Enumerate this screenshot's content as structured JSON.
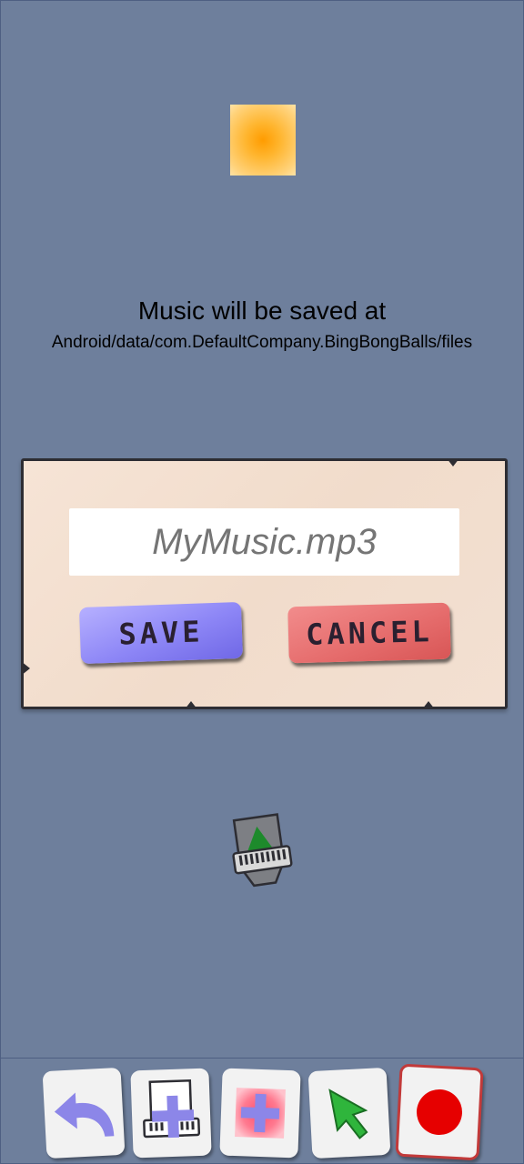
{
  "message": {
    "title": "Music will be saved at",
    "path": "Android/data/com.DefaultCompany.BingBongBalls/files"
  },
  "dialog": {
    "filename_placeholder": "MyMusic.mp3",
    "filename_value": "",
    "save_label": "SAVE",
    "cancel_label": "CANCEL"
  },
  "toolbar": {
    "items": [
      {
        "icon": "undo-icon"
      },
      {
        "icon": "add-keyboard-icon"
      },
      {
        "icon": "add-ball-icon"
      },
      {
        "icon": "select-pointer-icon"
      },
      {
        "icon": "record-icon"
      }
    ]
  },
  "colors": {
    "background": "#6e7f9c",
    "dialog_bg": "#f3e0d2",
    "save": "#8d86f6",
    "cancel": "#e56b6b",
    "orb": "#ff9c00",
    "record": "#e60000"
  }
}
